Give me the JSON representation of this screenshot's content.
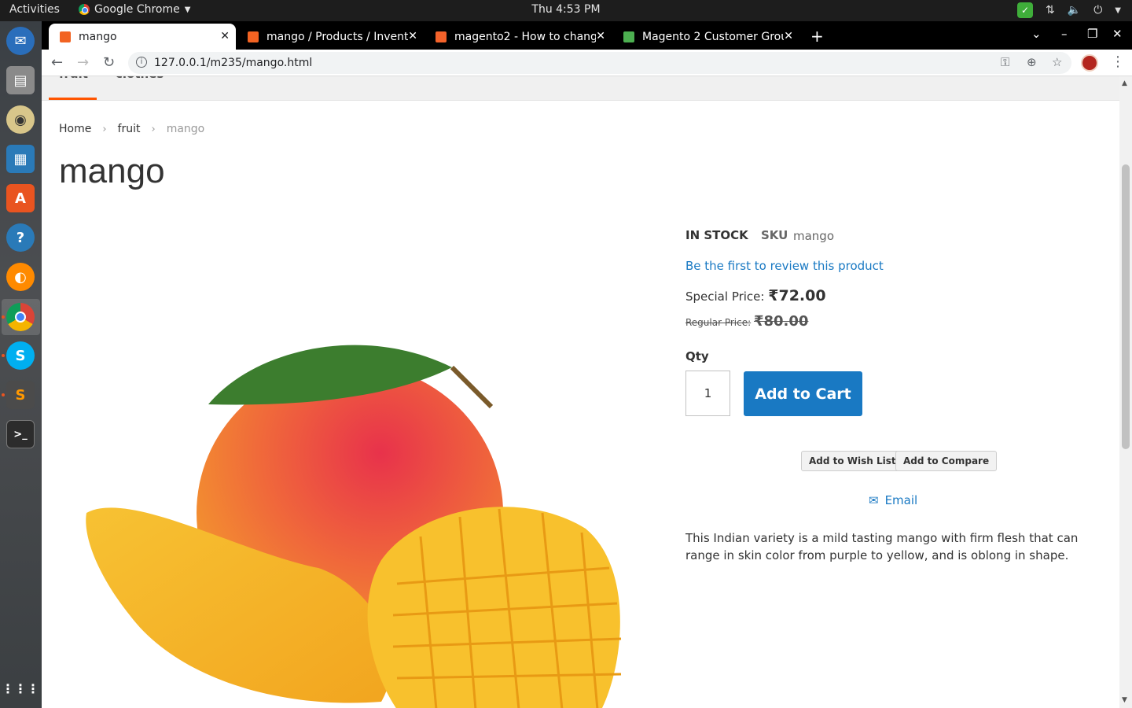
{
  "os": {
    "activities": "Activities",
    "app_name": "Google Chrome",
    "clock": "Thu  4:53 PM"
  },
  "browser": {
    "tabs": [
      {
        "label": "mango",
        "active": true
      },
      {
        "label": "mango / Products / Invent",
        "active": false
      },
      {
        "label": "magento2 - How to chang",
        "active": false
      },
      {
        "label": "Magento 2 Customer Grou",
        "active": false
      }
    ],
    "url": "127.0.0.1/m235/mango.html"
  },
  "site_nav": {
    "items": [
      "fruit",
      "clothes"
    ]
  },
  "breadcrumb": {
    "home": "Home",
    "category": "fruit",
    "current": "mango"
  },
  "product": {
    "title": "mango",
    "stock": "IN STOCK",
    "sku_label": "SKU",
    "sku": "mango",
    "review_link": "Be the first to review this product",
    "special_label": "Special Price:",
    "special_price": "₹72.00",
    "regular_label": "Regular Price:",
    "regular_price": "₹80.00",
    "qty_label": "Qty",
    "qty": "1",
    "add_to_cart": "Add to Cart",
    "wishlist": "Add to Wish List",
    "compare": "Add to Compare",
    "email": "Email",
    "description": "This Indian variety is a mild tasting mango with firm flesh that can range in skin color from purple to yellow, and is oblong in shape."
  },
  "colors": {
    "accent": "#1979c3",
    "nav_underline": "#ff5501"
  }
}
